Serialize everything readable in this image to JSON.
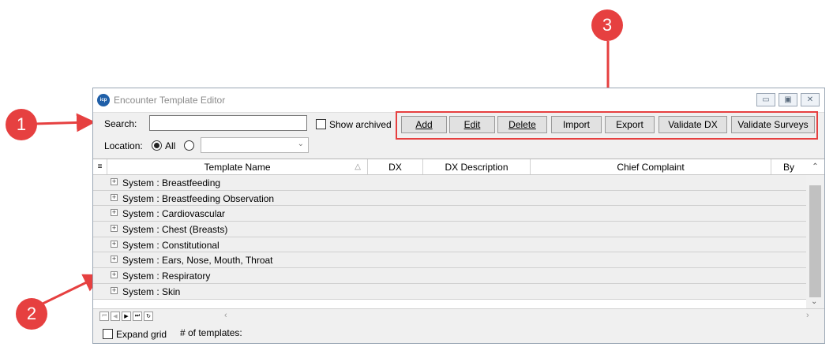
{
  "callouts": [
    "1",
    "2",
    "3"
  ],
  "window": {
    "title": "Encounter Template Editor",
    "app_icon_text": "icp",
    "controls": {
      "minimize": "▭",
      "maximize": "▣",
      "close": "✕"
    }
  },
  "toolbar": {
    "search_label": "Search:",
    "search_value": "",
    "show_archived_label": "Show archived",
    "location_label": "Location:",
    "location_all_label": "All",
    "location_value": "",
    "buttons": [
      {
        "key": "add",
        "label": "Add",
        "underline": true
      },
      {
        "key": "edit",
        "label": "Edit",
        "underline": true
      },
      {
        "key": "delete",
        "label": "Delete",
        "underline": true
      },
      {
        "key": "import",
        "label": "Import",
        "underline": false
      },
      {
        "key": "export",
        "label": "Export",
        "underline": false
      },
      {
        "key": "validate-dx",
        "label": "Validate DX",
        "underline": false
      },
      {
        "key": "validate-surveys",
        "label": "Validate Surveys",
        "underline": false
      }
    ]
  },
  "grid": {
    "columns": [
      "Template Name",
      "DX",
      "DX Description",
      "Chief Complaint",
      "By"
    ],
    "sort_indicator": "△",
    "rows": [
      "System : Breastfeeding",
      "System : Breastfeeding Observation",
      "System : Cardiovascular",
      "System : Chest (Breasts)",
      "System : Constitutional",
      "System : Ears, Nose, Mouth, Throat",
      "System : Respiratory",
      "System : Skin"
    ],
    "expander_glyph": "+"
  },
  "footer": {
    "expand_grid_label": "Expand grid",
    "templates_count_label": "# of templates:"
  },
  "colors": {
    "callout": "#e64040",
    "highlight_box": "#e64040"
  }
}
